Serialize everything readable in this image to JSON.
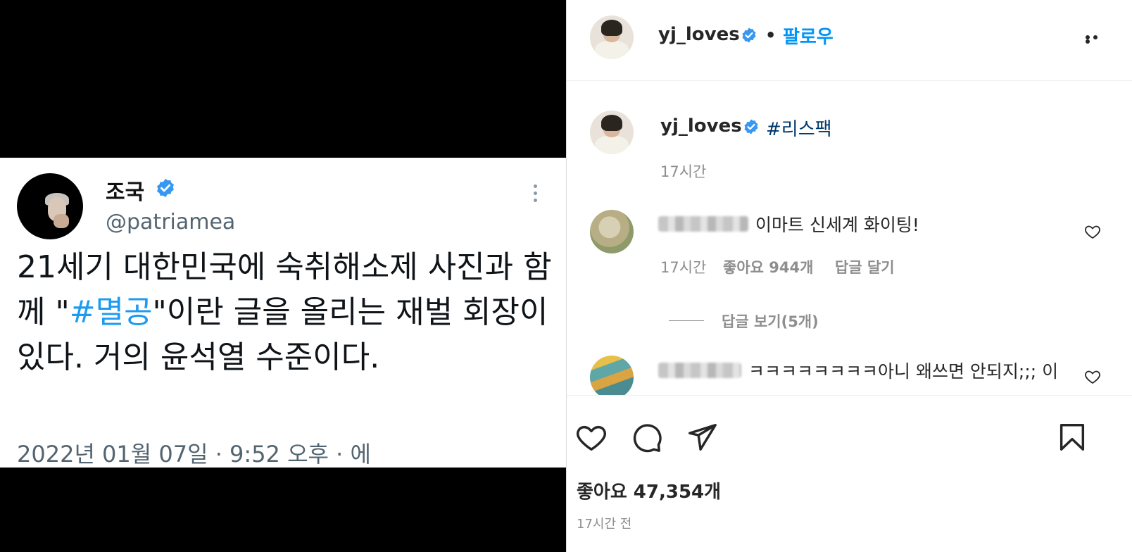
{
  "tweet": {
    "name": "조국",
    "handle": "@patriamea",
    "text_before": "21세기 대한민국에 숙취해소제 사진과 함께 \"",
    "hashtag": "#멸공",
    "text_after": "\"이란 글을 올리는 재벌 회장이 있다. 거의 윤석열 수준이다.",
    "meta": "2022년 01월 07일 · 9:52 오후 · 에"
  },
  "post": {
    "username": "yj_loves",
    "separator": "•",
    "follow_label": "팔로우",
    "caption_user": "yj_loves",
    "caption_hashtag": "#리스팩",
    "caption_time": "17시간"
  },
  "comments": [
    {
      "text": "이마트 신세계 화이팅!",
      "time": "17시간",
      "likes": "좋아요 944개",
      "reply": "답글 달기"
    },
    {
      "text": "ㅋㅋㅋㅋㅋㅋㅋㅋ아니 왜쓰면 안되지;;; 이"
    }
  ],
  "replies_view": "답글 보기(5개)",
  "likes_count": "좋아요 47,354개",
  "time_ago": "17시간 전",
  "colors": {
    "accent": "#0095f6",
    "hashtag_link": "#00376b",
    "tweet_hashtag": "#1d9bf0",
    "verified": "#3897f0",
    "muted": "#8e8e8e"
  },
  "icons": [
    "verified-badge-icon",
    "more-icon",
    "heart-icon",
    "comment-icon",
    "share-icon",
    "bookmark-icon"
  ]
}
